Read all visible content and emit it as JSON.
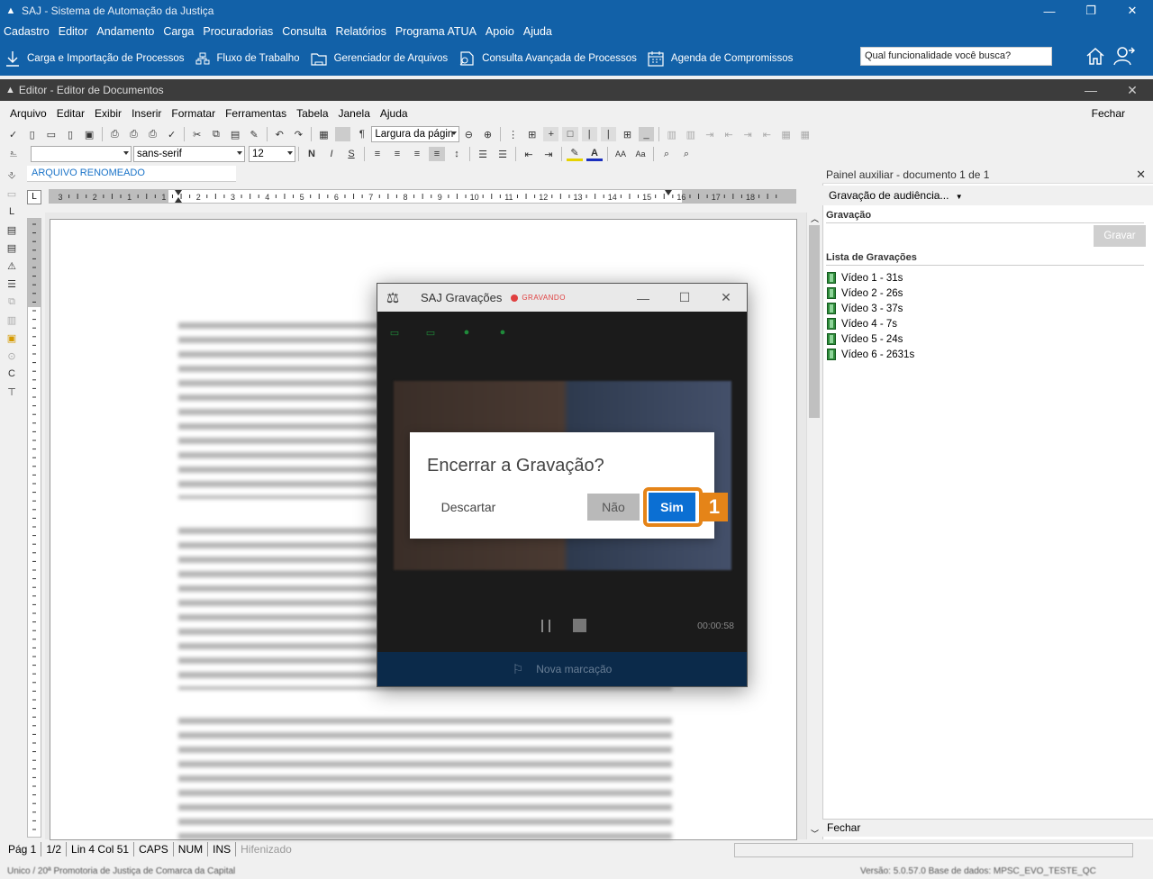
{
  "saj": {
    "title": "SAJ - Sistema de Automação da Justiça",
    "menu": [
      "Cadastro",
      "Editor",
      "Andamento",
      "Carga",
      "Procuradorias",
      "Consulta",
      "Relatórios",
      "Programa ATUA",
      "Apoio",
      "Ajuda"
    ],
    "toolbar": [
      {
        "label": "Carga e Importação de Processos",
        "icon": "download-icon"
      },
      {
        "label": "Fluxo de Trabalho",
        "icon": "workflow-icon"
      },
      {
        "label": "Gerenciador de Arquivos",
        "icon": "folder-icon"
      },
      {
        "label": "Consulta Avançada de Processos",
        "icon": "search-doc-icon"
      },
      {
        "label": "Agenda de Compromissos",
        "icon": "calendar-icon"
      }
    ],
    "search_placeholder": "Qual funcionalidade você busca?"
  },
  "editor": {
    "title": "Editor - Editor de Documentos",
    "menu": [
      "Arquivo",
      "Editar",
      "Exibir",
      "Inserir",
      "Formatar",
      "Ferramentas",
      "Tabela",
      "Janela",
      "Ajuda"
    ],
    "close_label": "Fechar",
    "zoom": "Largura da págin",
    "font": "sans-serif",
    "font_size": "12",
    "style": "",
    "doc_tab": "ARQUIVO RENOMEADO",
    "ruler_numbers": [
      "3",
      "2",
      "1",
      "1",
      "2",
      "3",
      "4",
      "5",
      "6",
      "7",
      "8",
      "9",
      "10",
      "11",
      "12",
      "13",
      "14",
      "15",
      "16",
      "17",
      "18"
    ]
  },
  "status": {
    "page": "Pág 1",
    "pages": "1/2",
    "position": "Lin 4  Col 51",
    "caps": "CAPS",
    "num": "NUM",
    "ins": "INS",
    "hyphen": "Hifenizado"
  },
  "bottom": {
    "left": "Unico / 20ª Promotoria de Justiça de Comarca da Capital",
    "right": "Versão: 5.0.57.0      Base de dados: MPSC_EVO_TESTE_QC"
  },
  "panel": {
    "header": "Painel auxiliar - documento 1 de 1",
    "combo": "Gravação de audiência...",
    "section_gravacao": "Gravação",
    "gravar_button": "Gravar",
    "section_lista": "Lista de Gravações",
    "recordings": [
      "Vídeo 1 - 31s",
      "Vídeo 2 - 26s",
      "Vídeo 3 - 37s",
      "Vídeo 4 - 7s",
      "Vídeo 5 - 24s",
      "Vídeo 6 - 2631s"
    ],
    "close_label": "Fechar"
  },
  "recorder": {
    "title": "SAJ Gravações",
    "status": "GRAVANDO",
    "logo_sub": "REC",
    "elapsed": "00:00:58",
    "marker_label": "Nova marcação"
  },
  "dialog": {
    "question": "Encerrar a Gravação?",
    "discard": "Descartar",
    "no": "Não",
    "yes": "Sim"
  },
  "annotation": {
    "step": "1",
    "color": "#e58418"
  }
}
